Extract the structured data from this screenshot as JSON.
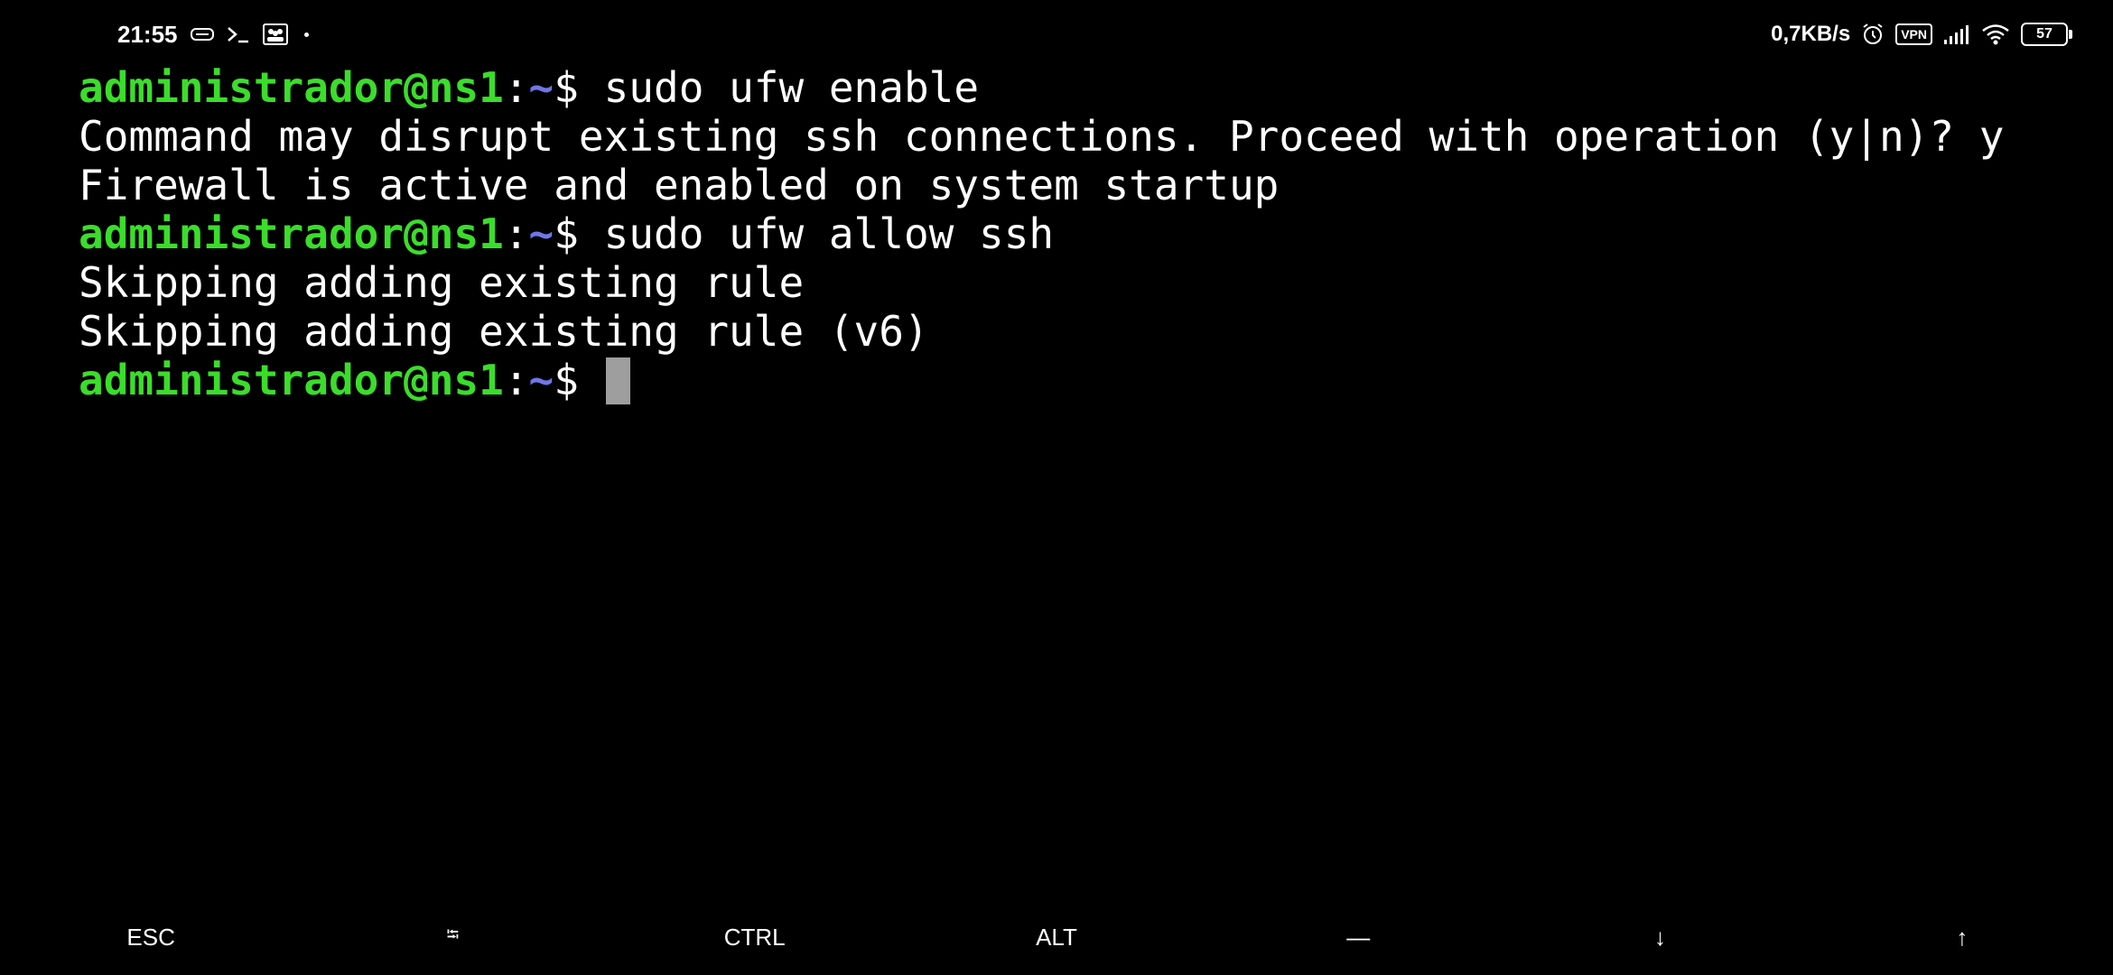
{
  "status_bar": {
    "time": "21:55",
    "net_speed": "0,7KB/s",
    "vpn_label": "VPN",
    "battery_level": "57",
    "left_icons": [
      "notification-chip-icon",
      "terminal-prompt-icon",
      "contacts-card-icon",
      "more-dot-icon"
    ],
    "right_icons": [
      "alarm-icon",
      "vpn-icon",
      "signal-icon",
      "wifi-icon",
      "battery-icon"
    ]
  },
  "terminal": {
    "colors": {
      "user_host": "#3bdd2b",
      "path": "#6f76e8",
      "text": "#ffffff",
      "cursor": "#9e9e9e",
      "background": "#000000"
    },
    "lines": [
      {
        "type": "prompt",
        "user_host": "administrador@ns1",
        "colon": ":",
        "path": "~",
        "dollar": "$",
        "command": " sudo ufw enable"
      },
      {
        "type": "output",
        "text": "Command may disrupt existing ssh connections. Proceed with operation (y|n)? y"
      },
      {
        "type": "output",
        "text": "Firewall is active and enabled on system startup"
      },
      {
        "type": "prompt",
        "user_host": "administrador@ns1",
        "colon": ":",
        "path": "~",
        "dollar": "$",
        "command": " sudo ufw allow ssh"
      },
      {
        "type": "output",
        "text": "Skipping adding existing rule"
      },
      {
        "type": "output",
        "text": "Skipping adding existing rule (v6)"
      },
      {
        "type": "prompt",
        "user_host": "administrador@ns1",
        "colon": ":",
        "path": "~",
        "dollar": "$",
        "command": " "
      }
    ]
  },
  "extra_keys": {
    "esc": "ESC",
    "tab": "⭾",
    "ctrl": "CTRL",
    "alt": "ALT",
    "dash": "—",
    "down": "↓",
    "up": "↑"
  }
}
